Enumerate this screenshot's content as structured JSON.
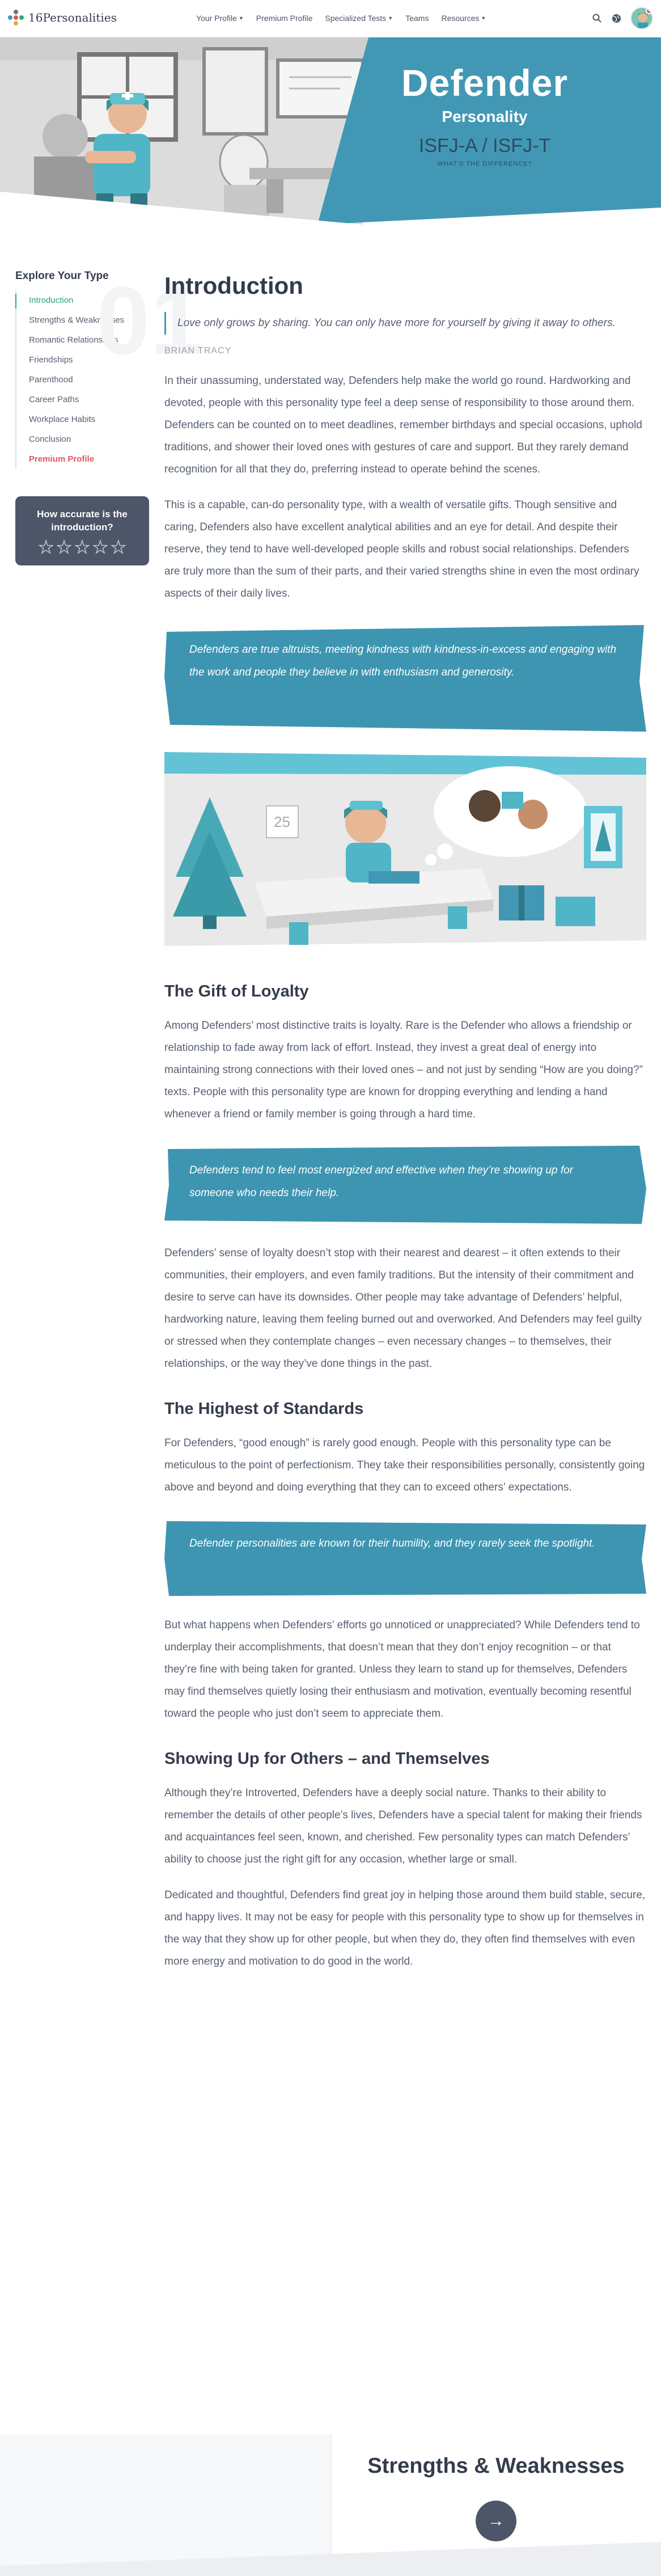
{
  "brand": {
    "name": "16Personalities",
    "accent": "#33a474",
    "blue": "#4298b4",
    "premium": "#e0575b"
  },
  "nav": {
    "items": [
      {
        "label": "Your Profile",
        "has_caret": true
      },
      {
        "label": "Premium Profile",
        "has_caret": false
      },
      {
        "label": "Specialized Tests",
        "has_caret": true
      },
      {
        "label": "Teams",
        "has_caret": false
      },
      {
        "label": "Resources",
        "has_caret": true
      }
    ],
    "icons": [
      "search-icon",
      "language-globe-icon",
      "user-avatar"
    ]
  },
  "hero": {
    "name": "Defender",
    "subtitle": "Personality",
    "codes": "ISFJ-A / ISFJ-T",
    "diff_link": "What's the difference?"
  },
  "sidebar": {
    "heading": "Explore Your Type",
    "items": [
      {
        "label": "Introduction",
        "state": "active"
      },
      {
        "label": "Strengths & Weaknesses",
        "state": "normal"
      },
      {
        "label": "Romantic Relationships",
        "state": "normal"
      },
      {
        "label": "Friendships",
        "state": "normal"
      },
      {
        "label": "Parenthood",
        "state": "normal"
      },
      {
        "label": "Career Paths",
        "state": "normal"
      },
      {
        "label": "Workplace Habits",
        "state": "normal"
      },
      {
        "label": "Conclusion",
        "state": "normal"
      },
      {
        "label": "Premium Profile",
        "state": "premium"
      }
    ],
    "rating": {
      "title": "How accurate is the introduction?",
      "stars": 5
    }
  },
  "article": {
    "section_number": "01",
    "title": "Introduction",
    "quote": "Love only grows by sharing. You can only have more for yourself by giving it away to others.",
    "quote_author": "Brian Tracy",
    "p1": "In their unassuming, understated way, Defenders help make the world go round. Hardworking and devoted, people with this personality type feel a deep sense of responsibility to those around them. Defenders can be counted on to meet deadlines, remember birthdays and special occasions, uphold traditions, and shower their loved ones with gestures of care and support. But they rarely demand recognition for all that they do, preferring instead to operate behind the scenes.",
    "p2": "This is a capable, can-do personality type, with a wealth of versatile gifts. Though sensitive and caring, Defenders also have excellent analytical abilities and an eye for detail. And despite their reserve, they tend to have well-developed people skills and robust social relationships. Defenders are truly more than the sum of their parts, and their varied strengths shine in even the most ordinary aspects of their daily lives.",
    "callout1": "Defenders are true altruists, meeting kindness with kindness-in-excess and engaging with the work and people they believe in with enthusiasm and generosity.",
    "calendar_text": "25",
    "h_loyalty": "The Gift of Loyalty",
    "p3": "Among Defenders’ most distinctive traits is loyalty. Rare is the Defender who allows a friendship or relationship to fade away from lack of effort. Instead, they invest a great deal of energy into maintaining strong connections with their loved ones – and not just by sending “How are you doing?” texts. People with this personality type are known for dropping everything and lending a hand whenever a friend or family member is going through a hard time.",
    "callout2": "Defenders tend to feel most energized and effective when they’re showing up for someone who needs their help.",
    "p4": "Defenders’ sense of loyalty doesn’t stop with their nearest and dearest – it often extends to their communities, their employers, and even family traditions. But the intensity of their commitment and desire to serve can have its downsides. Other people may take advantage of Defenders’ helpful, hardworking nature, leaving them feeling burned out and overworked. And Defenders may feel guilty or stressed when they contemplate changes – even necessary changes – to themselves, their relationships, or the way they’ve done things in the past.",
    "h_standards": "The Highest of Standards",
    "p5": "For Defenders, “good enough” is rarely good enough. People with this personality type can be meticulous to the point of perfectionism. They take their responsibilities personally, consistently going above and beyond and doing everything that they can to exceed others’ expectations.",
    "callout3": "Defender personalities are known for their humility, and they rarely seek the spotlight.",
    "p6": "But what happens when Defenders’ efforts go unnoticed or unappreciated? While Defenders tend to underplay their accomplishments, that doesn’t mean that they don’t enjoy recognition – or that they’re fine with being taken for granted. Unless they learn to stand up for themselves, Defenders may find themselves quietly losing their enthusiasm and motivation, eventually becoming resentful toward the people who just don’t seem to appreciate them.",
    "h_showing": "Showing Up for Others – and Themselves",
    "p7": "Although they’re Introverted, Defenders have a deeply social nature. Thanks to their ability to remember the details of other people’s lives, Defenders have a special talent for making their friends and acquaintances feel seen, known, and cherished. Few personality types can match Defenders’ ability to choose just the right gift for any occasion, whether large or small.",
    "p8": "Dedicated and thoughtful, Defenders find great joy in helping those around them build stable, secure, and happy lives. It may not be easy for people with this personality type to show up for themselves in the way that they show up for other people, but when they do, they often find themselves with even more energy and motivation to do good in the world."
  },
  "next": {
    "title": "Strengths & Weaknesses",
    "button_glyph": "→"
  }
}
